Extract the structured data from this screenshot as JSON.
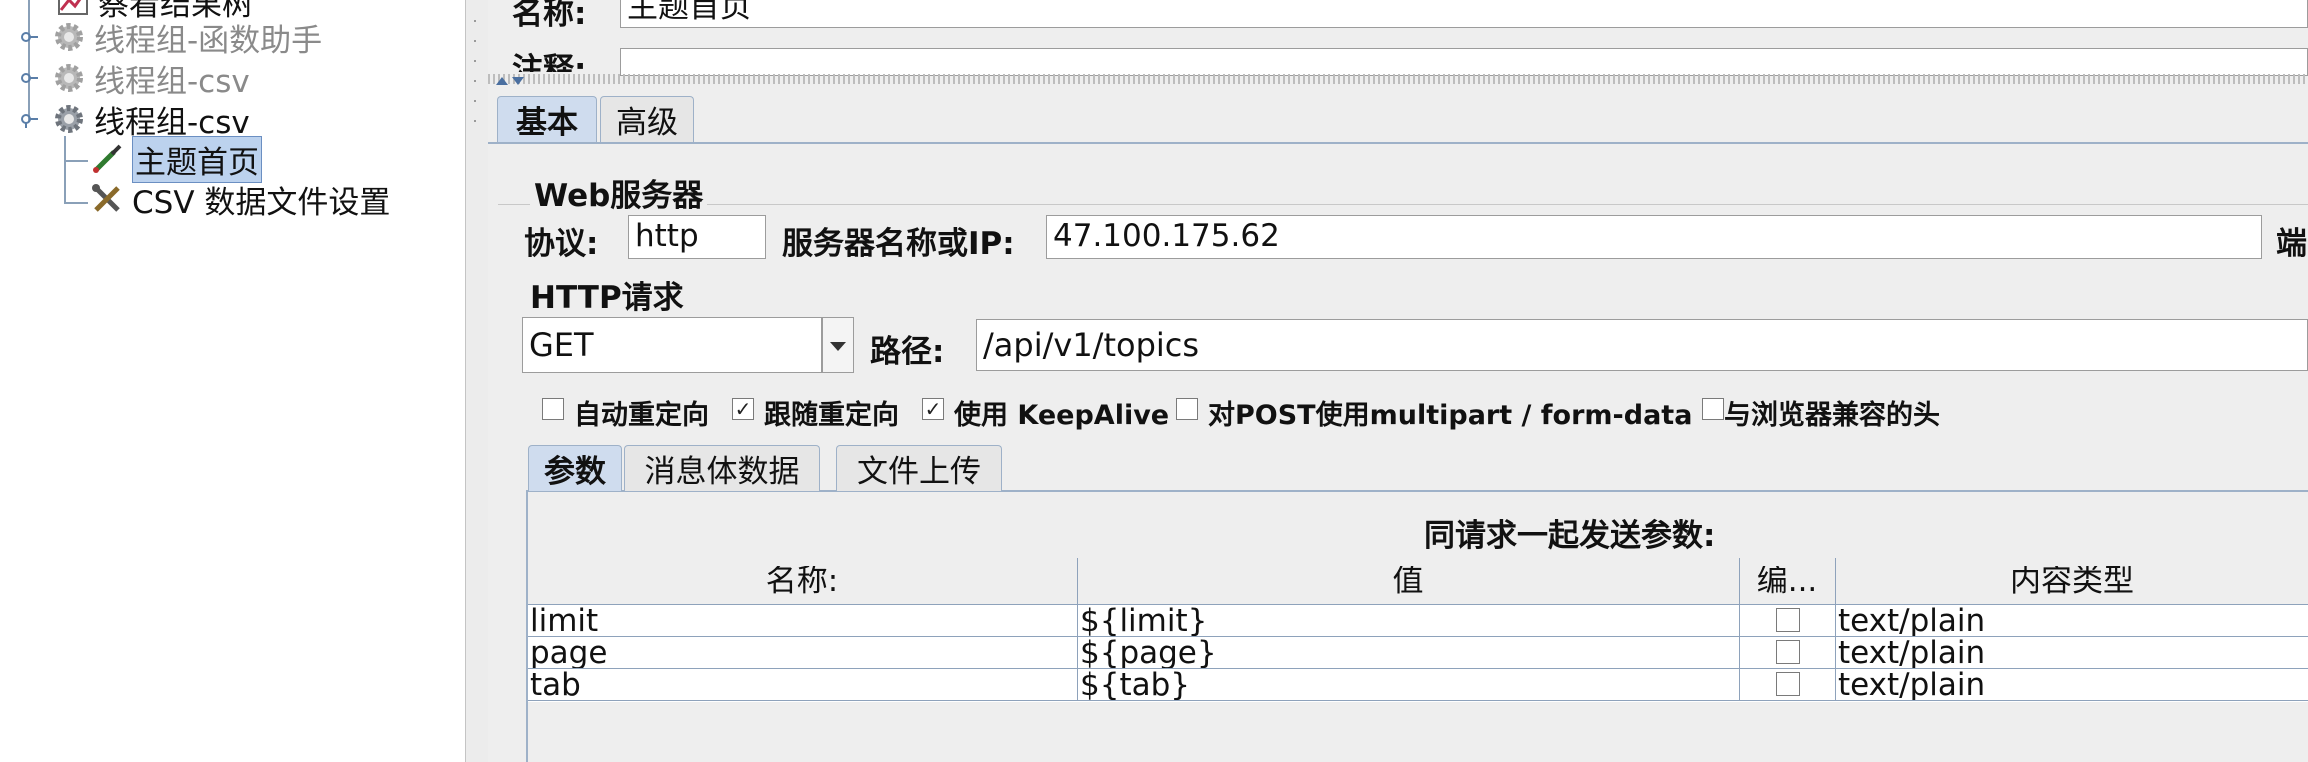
{
  "tree": {
    "items": [
      {
        "label": "察看结果树",
        "state": "normal"
      },
      {
        "label": "线程组-函数助手",
        "state": "disabled"
      },
      {
        "label": "线程组-csv",
        "state": "disabled"
      },
      {
        "label": "线程组-csv",
        "state": "normal"
      },
      {
        "label": "主题首页",
        "state": "selected"
      },
      {
        "label": "CSV 数据文件设置",
        "state": "normal"
      }
    ]
  },
  "form": {
    "name_label": "名称:",
    "name_value": "主题首页",
    "comment_label": "注释:",
    "comment_value": ""
  },
  "main_tabs": [
    {
      "label": "基本",
      "active": true
    },
    {
      "label": "高级",
      "active": false
    }
  ],
  "web_server": {
    "section_title": "Web服务器",
    "protocol_label": "协议:",
    "protocol_value": "http",
    "server_label": "服务器名称或IP:",
    "server_value": "47.100.175.62",
    "port_label_fragment": "端"
  },
  "http_request": {
    "section_title": "HTTP请求",
    "method_value": "GET",
    "path_label": "路径:",
    "path_value": "/api/v1/topics",
    "options": [
      {
        "label": "自动重定向",
        "checked": false
      },
      {
        "label": "跟随重定向",
        "checked": true
      },
      {
        "label": "使用 KeepAlive",
        "checked": true
      },
      {
        "label": "对POST使用multipart / form-data",
        "checked": false
      },
      {
        "label": "与浏览器兼容的头",
        "checked": false
      }
    ]
  },
  "sub_tabs": [
    {
      "label": "参数",
      "active": true
    },
    {
      "label": "消息体数据",
      "active": false
    },
    {
      "label": "文件上传",
      "active": false
    }
  ],
  "params": {
    "caption": "同请求一起发送参数:",
    "columns": [
      "名称:",
      "值",
      "编...",
      "内容类型"
    ],
    "rows": [
      {
        "name": "limit",
        "value": "${limit}",
        "encode": false,
        "content_type": "text/plain"
      },
      {
        "name": "page",
        "value": "${page}",
        "encode": false,
        "content_type": "text/plain"
      },
      {
        "name": "tab",
        "value": "${tab}",
        "encode": false,
        "content_type": "text/plain"
      }
    ]
  },
  "colors": {
    "accent": "#cfdcee",
    "selection": "#bcd2ee",
    "panel_bg": "#eeeeee",
    "disabled_text": "#8a8a8a"
  }
}
